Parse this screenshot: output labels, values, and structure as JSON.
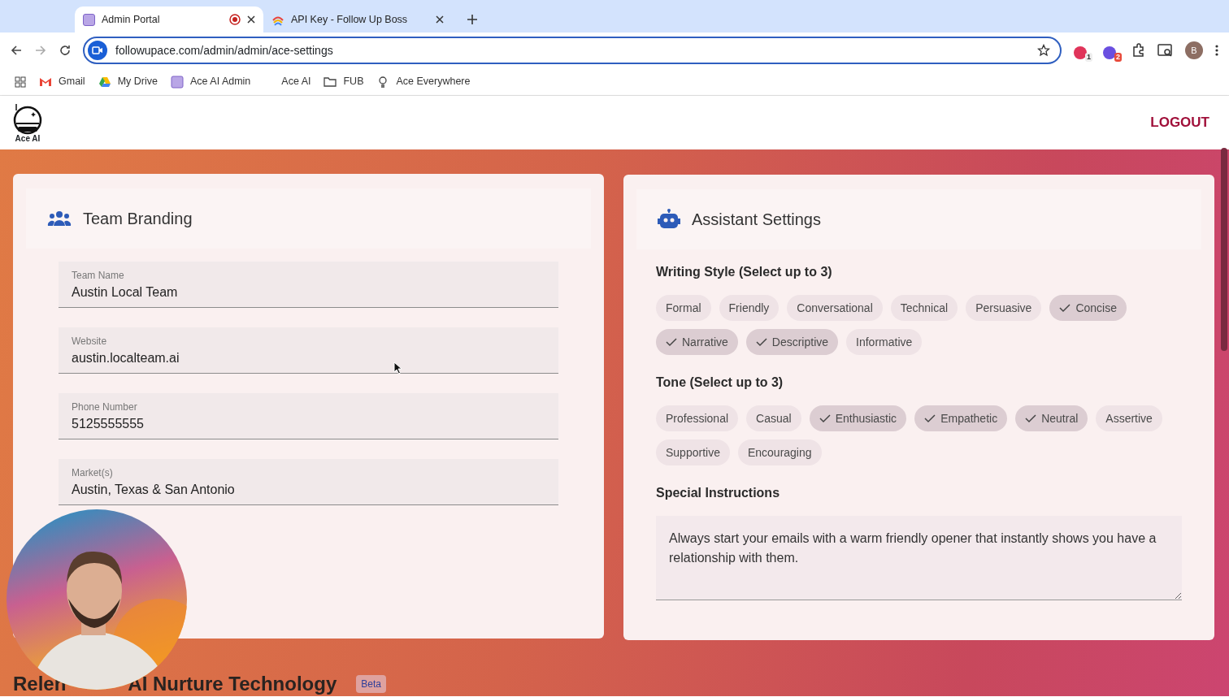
{
  "browser": {
    "tabs": [
      {
        "title": "Admin Portal",
        "selected": true,
        "recording": true
      },
      {
        "title": "API Key - Follow Up Boss",
        "selected": false,
        "recording": false
      }
    ],
    "url": "followupace.com/admin/admin/ace-settings",
    "extension_badges": [
      "1",
      "2"
    ],
    "profile_initial": "B",
    "bookmarks": [
      {
        "kind": "gmail",
        "label": "Gmail"
      },
      {
        "kind": "drive",
        "label": "My Drive"
      },
      {
        "kind": "app",
        "label": "Ace AI Admin"
      },
      {
        "kind": "none",
        "label": "Ace AI"
      },
      {
        "kind": "folder",
        "label": "FUB"
      },
      {
        "kind": "bulb",
        "label": "Ace Everywhere"
      }
    ]
  },
  "header": {
    "logo_text": "Ace AI",
    "logout": "LOGOUT"
  },
  "team_branding": {
    "title": "Team Branding",
    "fields": [
      {
        "label": "Team Name",
        "value": "Austin Local Team"
      },
      {
        "label": "Website",
        "value": "austin.localteam.ai"
      },
      {
        "label": "Phone Number",
        "value": "5125555555"
      },
      {
        "label": "Market(s)",
        "value": "Austin, Texas & San Antonio"
      }
    ]
  },
  "assistant_settings": {
    "title": "Assistant Settings",
    "groups": [
      {
        "title": "Writing Style (Select up to 3)",
        "options": [
          {
            "label": "Formal",
            "selected": false
          },
          {
            "label": "Friendly",
            "selected": false
          },
          {
            "label": "Conversational",
            "selected": false
          },
          {
            "label": "Technical",
            "selected": false
          },
          {
            "label": "Persuasive",
            "selected": false
          },
          {
            "label": "Concise",
            "selected": true
          },
          {
            "label": "Narrative",
            "selected": true
          },
          {
            "label": "Descriptive",
            "selected": true
          },
          {
            "label": "Informative",
            "selected": false
          }
        ]
      },
      {
        "title": "Tone (Select up to 3)",
        "options": [
          {
            "label": "Professional",
            "selected": false
          },
          {
            "label": "Casual",
            "selected": false
          },
          {
            "label": "Enthusiastic",
            "selected": true
          },
          {
            "label": "Empathetic",
            "selected": true
          },
          {
            "label": "Neutral",
            "selected": true
          },
          {
            "label": "Assertive",
            "selected": false
          },
          {
            "label": "Supportive",
            "selected": false
          },
          {
            "label": "Encouraging",
            "selected": false
          }
        ]
      }
    ],
    "special_instructions": {
      "title": "Special Instructions",
      "value": "Always start your emails with a warm friendly opener that instantly shows you have a relationship with them."
    }
  },
  "section_heading": {
    "parts": [
      "Relen",
      "AI Nurture Technology"
    ],
    "badge": "Beta"
  }
}
